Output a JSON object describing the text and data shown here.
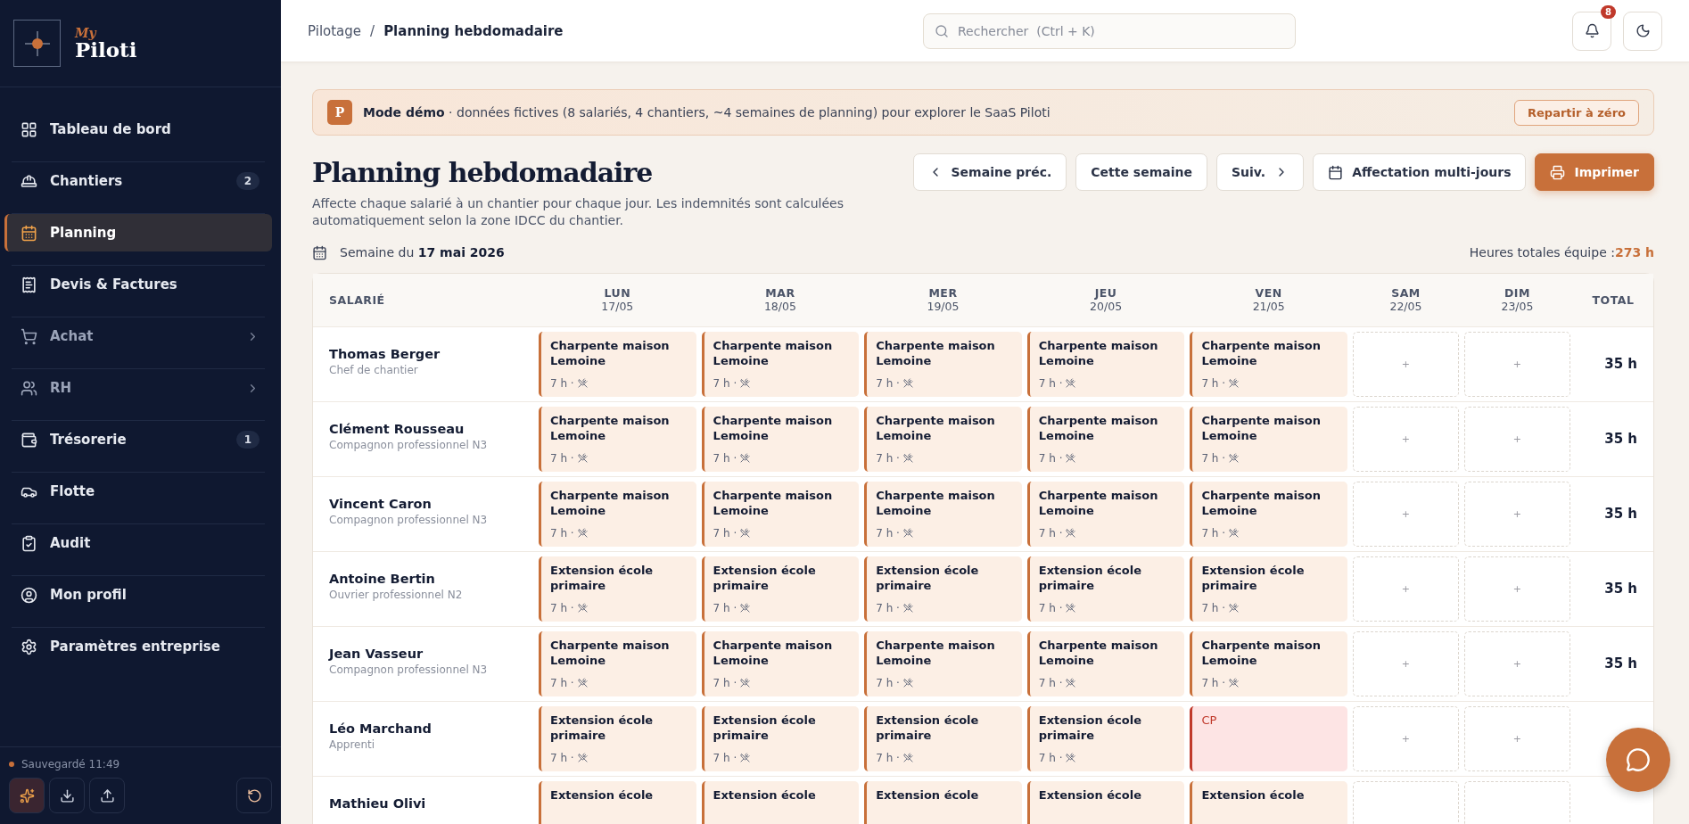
{
  "sidebar": {
    "logo": {
      "small": "My",
      "large": "Piloti"
    },
    "items": [
      {
        "label": "Tableau de bord",
        "selected": false,
        "expandable": false
      },
      {
        "label": "Chantiers",
        "selected": false,
        "expandable": false,
        "badge": "2"
      },
      {
        "label": "Planning",
        "selected": true,
        "expandable": false
      },
      {
        "label": "Devis & Factures",
        "selected": false,
        "expandable": false
      },
      {
        "label": "Achat",
        "selected": false,
        "expandable": true
      },
      {
        "label": "RH",
        "selected": false,
        "expandable": true
      },
      {
        "label": "Trésorerie",
        "selected": false,
        "expandable": false,
        "badge": "1"
      },
      {
        "label": "Flotte",
        "selected": false,
        "expandable": false
      },
      {
        "label": "Audit",
        "selected": false,
        "expandable": false
      }
    ],
    "footer_items": [
      {
        "label": "Mon profil"
      },
      {
        "label": "Paramètres entreprise"
      }
    ],
    "save_status": "Sauvegardé 11:49"
  },
  "header": {
    "breadcrumb": [
      "Pilotage",
      "/",
      "Planning hebdomadaire"
    ],
    "search": {
      "placeholder": "Rechercher  (Ctrl + K)"
    },
    "notifications": "8"
  },
  "banner": {
    "badge": "P",
    "text": "**Mode démo** · données fictives (8 salariés, 4 chantiers, ~4 semaines de planning) pour explorer le SaaS Piloti",
    "button": "Repartir à zéro"
  },
  "page": {
    "title": "Planning hebdomadaire",
    "description": "Affecte chaque salarié à un chantier pour chaque jour. Les indemnités sont calculées automatiquement selon la zone IDCC du chantier.",
    "buttons": [
      {
        "label": "Semaine préc.",
        "kind": "prev"
      },
      {
        "label": "Cette semaine",
        "kind": "plain"
      },
      {
        "label": "Suiv.",
        "kind": "next"
      },
      {
        "label": "Affectation multi-jours",
        "kind": "calendar"
      },
      {
        "label": "Imprimer",
        "kind": "primary"
      }
    ],
    "week": "Semaine du **17 mai 2026**",
    "total_label": "Heures totales équipe : ",
    "total_value": "273 h"
  },
  "table": {
    "columns": [
      {
        "label": "SALARIÉ"
      },
      {
        "label": "LUN",
        "date": "17/05"
      },
      {
        "label": "MAR",
        "date": "18/05"
      },
      {
        "label": "MER",
        "date": "19/05"
      },
      {
        "label": "JEU",
        "date": "20/05"
      },
      {
        "label": "VEN",
        "date": "21/05"
      },
      {
        "label": "SAM",
        "date": "22/05"
      },
      {
        "label": "DIM",
        "date": "23/05"
      },
      {
        "label": "TOTAL"
      }
    ],
    "rows": [
      {
        "name": "Thomas Berger",
        "role": "Chef de chantier",
        "total": "35 h",
        "days": [
          {
            "kind": "site",
            "label": "Charpente maison Lemoine",
            "hours": "7 h ·"
          },
          {
            "kind": "site",
            "label": "Charpente maison Lemoine",
            "hours": "7 h ·"
          },
          {
            "kind": "site",
            "label": "Charpente maison Lemoine",
            "hours": "7 h ·"
          },
          {
            "kind": "site",
            "label": "Charpente maison Lemoine",
            "hours": "7 h ·"
          },
          {
            "kind": "site",
            "label": "Charpente maison Lemoine",
            "hours": "7 h ·"
          },
          {
            "kind": "empty",
            "label": "+"
          },
          {
            "kind": "empty",
            "label": "+"
          }
        ]
      },
      {
        "name": "Clément Rousseau",
        "role": "Compagnon professionnel N3",
        "total": "35 h",
        "days": [
          {
            "kind": "site",
            "label": "Charpente maison Lemoine",
            "hours": "7 h ·"
          },
          {
            "kind": "site",
            "label": "Charpente maison Lemoine",
            "hours": "7 h ·"
          },
          {
            "kind": "site",
            "label": "Charpente maison Lemoine",
            "hours": "7 h ·"
          },
          {
            "kind": "site",
            "label": "Charpente maison Lemoine",
            "hours": "7 h ·"
          },
          {
            "kind": "site",
            "label": "Charpente maison Lemoine",
            "hours": "7 h ·"
          },
          {
            "kind": "empty",
            "label": "+"
          },
          {
            "kind": "empty",
            "label": "+"
          }
        ]
      },
      {
        "name": "Vincent Caron",
        "role": "Compagnon professionnel N3",
        "total": "35 h",
        "days": [
          {
            "kind": "site",
            "label": "Charpente maison Lemoine",
            "hours": "7 h ·"
          },
          {
            "kind": "site",
            "label": "Charpente maison Lemoine",
            "hours": "7 h ·"
          },
          {
            "kind": "site",
            "label": "Charpente maison Lemoine",
            "hours": "7 h ·"
          },
          {
            "kind": "site",
            "label": "Charpente maison Lemoine",
            "hours": "7 h ·"
          },
          {
            "kind": "site",
            "label": "Charpente maison Lemoine",
            "hours": "7 h ·"
          },
          {
            "kind": "empty",
            "label": "+"
          },
          {
            "kind": "empty",
            "label": "+"
          }
        ]
      },
      {
        "name": "Antoine Bertin",
        "role": "Ouvrier professionnel N2",
        "total": "35 h",
        "days": [
          {
            "kind": "site",
            "label": "Extension école primaire",
            "hours": "7 h ·"
          },
          {
            "kind": "site",
            "label": "Extension école primaire",
            "hours": "7 h ·"
          },
          {
            "kind": "site",
            "label": "Extension école primaire",
            "hours": "7 h ·"
          },
          {
            "kind": "site",
            "label": "Extension école primaire",
            "hours": "7 h ·"
          },
          {
            "kind": "site",
            "label": "Extension école primaire",
            "hours": "7 h ·"
          },
          {
            "kind": "empty",
            "label": "+"
          },
          {
            "kind": "empty",
            "label": "+"
          }
        ]
      },
      {
        "name": "Jean Vasseur",
        "role": "Compagnon professionnel N3",
        "total": "35 h",
        "days": [
          {
            "kind": "site",
            "label": "Charpente maison Lemoine",
            "hours": "7 h ·"
          },
          {
            "kind": "site",
            "label": "Charpente maison Lemoine",
            "hours": "7 h ·"
          },
          {
            "kind": "site",
            "label": "Charpente maison Lemoine",
            "hours": "7 h ·"
          },
          {
            "kind": "site",
            "label": "Charpente maison Lemoine",
            "hours": "7 h ·"
          },
          {
            "kind": "site",
            "label": "Charpente maison Lemoine",
            "hours": "7 h ·"
          },
          {
            "kind": "empty",
            "label": "+"
          },
          {
            "kind": "empty",
            "label": "+"
          }
        ]
      },
      {
        "name": "Léo Marchand",
        "role": "Apprenti",
        "days": [
          {
            "kind": "site",
            "label": "Extension école primaire",
            "hours": "7 h ·"
          },
          {
            "kind": "site",
            "label": "Extension école primaire",
            "hours": "7 h ·"
          },
          {
            "kind": "site",
            "label": "Extension école primaire",
            "hours": "7 h ·"
          },
          {
            "kind": "site",
            "label": "Extension école primaire",
            "hours": "7 h ·"
          },
          {
            "kind": "leave",
            "label": "CP"
          },
          {
            "kind": "empty",
            "label": "+"
          },
          {
            "kind": "empty",
            "label": "+"
          }
        ]
      },
      {
        "name": "Mathieu Olivi",
        "days": [
          {
            "kind": "site",
            "label": "Extension école"
          },
          {
            "kind": "site",
            "label": "Extension école"
          },
          {
            "kind": "site",
            "label": "Extension école"
          },
          {
            "kind": "site",
            "label": "Extension école"
          },
          {
            "kind": "site",
            "label": "Extension école"
          },
          {
            "kind": "empty"
          },
          {
            "kind": "empty"
          }
        ]
      }
    ]
  }
}
